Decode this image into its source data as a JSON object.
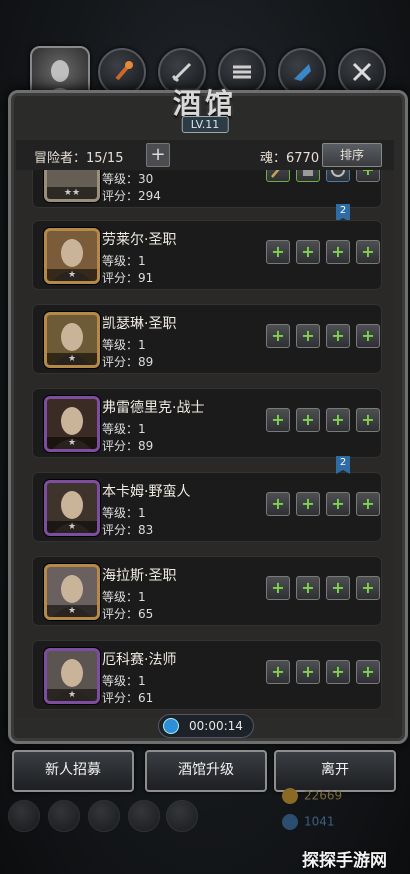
{
  "title": "酒馆",
  "level_badge": "LV.11",
  "header": {
    "adventurers_label": "冒险者：15/15",
    "add_symbol": "+",
    "soul_label": "魂：6770",
    "sort_label": "排序"
  },
  "partial_top_row": {
    "level": "等级：30",
    "score": "评分：294",
    "stars": "★★"
  },
  "heroes": [
    {
      "name": "劳莱尔·圣职",
      "level": "等级：1",
      "score": "评分：91",
      "stars": "★",
      "frame_color": "#b5894a",
      "portrait_bg": "#7a5c3b"
    },
    {
      "name": "凯瑟琳·圣职",
      "level": "等级：1",
      "score": "评分：89",
      "stars": "★",
      "frame_color": "#b5894a",
      "portrait_bg": "#6d5a36"
    },
    {
      "name": "弗雷德里克·战士",
      "level": "等级：1",
      "score": "评分：89",
      "stars": "★",
      "frame_color": "#7f4da0",
      "portrait_bg": "#3a2c24"
    },
    {
      "name": "本卡姆·野蛮人",
      "level": "等级：1",
      "score": "评分：83",
      "stars": "★",
      "frame_color": "#7f4da0",
      "portrait_bg": "#3f342c"
    },
    {
      "name": "海拉斯·圣职",
      "level": "等级：1",
      "score": "评分：65",
      "stars": "★",
      "frame_color": "#b5894a",
      "portrait_bg": "#6a6060"
    },
    {
      "name": "厄科赛·法师",
      "level": "等级：1",
      "score": "评分：61",
      "stars": "★",
      "frame_color": "#7f4da0",
      "portrait_bg": "#5b5450"
    }
  ],
  "slot_plus": "+",
  "badge_num": "2",
  "timer": "00:00:14",
  "buttons": {
    "recruit": "新人招募",
    "upgrade": "酒馆升级",
    "leave": "离开"
  },
  "resources": {
    "gold": "22669",
    "crystal": "1041"
  },
  "watermark": "探探手游网",
  "icons": [
    "hero-portrait-tab-icon",
    "torch-tab-icon",
    "weapon-tab-icon",
    "armor-tab-icon",
    "trinket-tab-icon",
    "crossed-swords-tab-icon"
  ]
}
